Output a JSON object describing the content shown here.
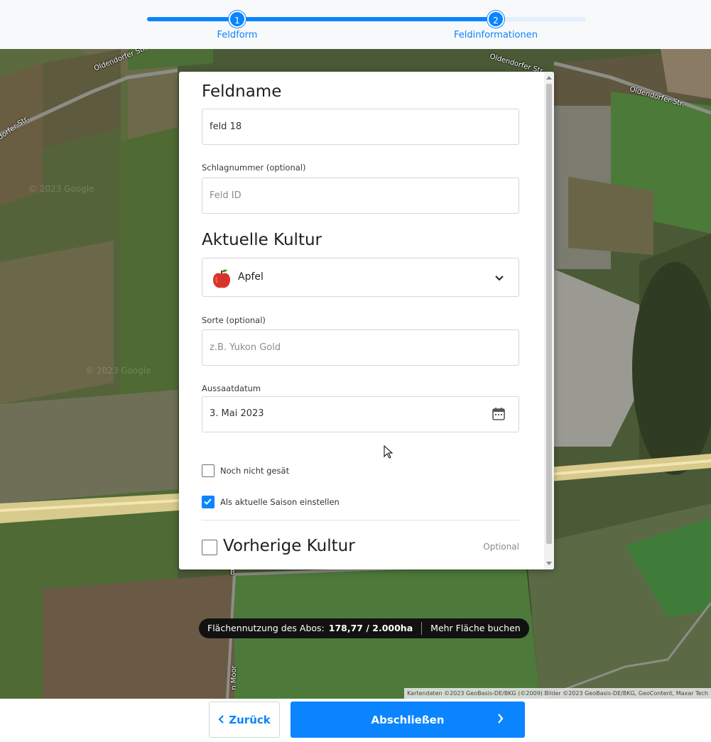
{
  "stepper": {
    "steps": [
      {
        "number": "1",
        "label": "Feldform"
      },
      {
        "number": "2",
        "label": "Feldinformationen"
      }
    ],
    "active_step": 2
  },
  "map": {
    "road_labels": [
      "Oldendorfer Str.",
      "Oldendorfer Str.",
      "Oldendorfer Str.",
      "dorfer Str.",
      "B",
      "n Moor"
    ],
    "watermark": "© 2023 Google",
    "attribution": "Kartendaten ©2023 GeoBasis-DE/BKG (©2009) Bilder ©2023 GeoBasis-DE/BKG, GeoContent, Maxar Tech"
  },
  "form": {
    "field_name_title": "Feldname",
    "field_name_value": "feld 18",
    "plot_number_label": "Schlagnummer (optional)",
    "plot_number_placeholder": "Feld ID",
    "current_crop_title": "Aktuelle Kultur",
    "crop_value": "Apfel",
    "crop_icon": "apple-icon",
    "variety_label": "Sorte (optional)",
    "variety_placeholder": "z.B. Yukon Gold",
    "sowing_date_label": "Aussaatdatum",
    "sowing_date_value": "3. Mai 2023",
    "not_sown_label": "Noch nicht gesät",
    "not_sown_checked": false,
    "current_season_label": "Als aktuelle Saison einstellen",
    "current_season_checked": true,
    "previous_crop_title": "Vorherige Kultur",
    "previous_crop_checked": false,
    "previous_crop_optional": "Optional"
  },
  "usage": {
    "label": "Flächennutzung des Abos:",
    "value": "178,77 / 2.000ha",
    "link": "Mehr Fläche buchen"
  },
  "buttons": {
    "back_label": "Zurück",
    "finish_label": "Abschließen"
  },
  "colors": {
    "accent": "#0a84ff",
    "pill_background": "#111111"
  }
}
